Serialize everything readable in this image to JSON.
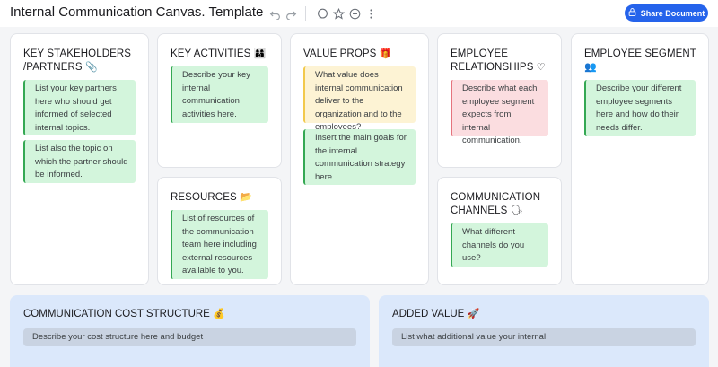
{
  "header": {
    "title": "Internal Communication Canvas. Template",
    "share_label": "Share Document"
  },
  "cards": {
    "stakeholders": {
      "title_line1": "KEY STAKEHOLDERS",
      "title_line2": "/PARTNERS",
      "emoji": "📎",
      "notes": [
        "List your key partners here who should get informed of selected internal topics.",
        "List also the topic on which the partner should be informed."
      ]
    },
    "activities": {
      "title": "KEY ACTIVITIES",
      "emoji": "👩‍👩‍👦",
      "notes": [
        "Describe your key internal communication activities here."
      ]
    },
    "resources": {
      "title": "RESOURCES",
      "emoji": "📂",
      "notes": [
        "List of resources of the communication team here including external resources available to you."
      ]
    },
    "value_props": {
      "title": "VALUE PROPS",
      "emoji": "🎁",
      "notes": [
        "What value does internal communication deliver to the organization and to the employees?",
        "Insert the main goals for the internal communication strategy here"
      ]
    },
    "relationships": {
      "title_line1": "EMPLOYEE",
      "title_line2": "RELATIONSHIPS",
      "emoji": "♡",
      "notes": [
        "Describe what each employee segment expects from internal communication."
      ]
    },
    "channels": {
      "title_line1": "COMMUNICATION",
      "title_line2": "CHANNELS",
      "emoji": "🗣",
      "notes": [
        "What different channels do you use?"
      ]
    },
    "segment": {
      "title": "EMPLOYEE SEGMENT",
      "emoji": "👥",
      "notes": [
        "Describe your different employee segments here and how do their needs differ."
      ]
    },
    "cost": {
      "title": "COMMUNICATION COST STRUCTURE",
      "emoji": "💰",
      "note": "Describe your cost structure here and budget"
    },
    "added_value": {
      "title": "ADDED VALUE",
      "emoji": "🚀",
      "note": "List what additional value your internal"
    }
  },
  "colors": {
    "accent": "#2563eb",
    "note_green": "#d3f5dc",
    "note_yellow": "#fdf3d4",
    "note_red": "#fbdde0",
    "bottom_panel": "#dbe8fb"
  },
  "icons": [
    "undo-icon",
    "redo-icon",
    "comment-icon",
    "star-icon",
    "add-icon",
    "more-icon",
    "share-icon"
  ]
}
